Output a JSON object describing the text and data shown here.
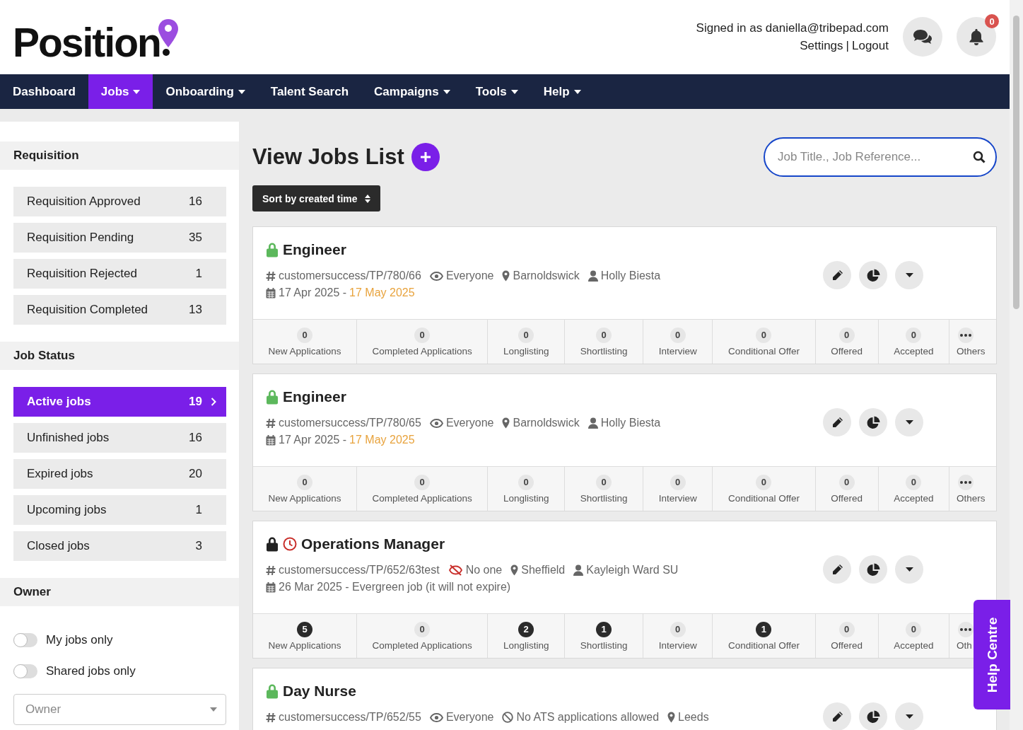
{
  "logo": {
    "text": "Position"
  },
  "account": {
    "signed_in": "Signed in as daniella@tribepad.com",
    "settings": "Settings",
    "separator": "|",
    "logout": "Logout",
    "notifications": "0"
  },
  "nav": [
    {
      "label": "Dashboard",
      "selected": false,
      "dropdown": false
    },
    {
      "label": "Jobs",
      "selected": true,
      "dropdown": true
    },
    {
      "label": "Onboarding",
      "selected": false,
      "dropdown": true
    },
    {
      "label": "Talent Search",
      "selected": false,
      "dropdown": false
    },
    {
      "label": "Campaigns",
      "selected": false,
      "dropdown": true
    },
    {
      "label": "Tools",
      "selected": false,
      "dropdown": true
    },
    {
      "label": "Help",
      "selected": false,
      "dropdown": true
    }
  ],
  "sidebar": {
    "sections": [
      {
        "title": "Requisition",
        "items": [
          {
            "label": "Requisition Approved",
            "count": "16",
            "selected": false
          },
          {
            "label": "Requisition Pending",
            "count": "35",
            "selected": false
          },
          {
            "label": "Requisition Rejected",
            "count": "1",
            "selected": false
          },
          {
            "label": "Requisition Completed",
            "count": "13",
            "selected": false
          }
        ]
      },
      {
        "title": "Job Status",
        "items": [
          {
            "label": "Active jobs",
            "count": "19",
            "selected": true
          },
          {
            "label": "Unfinished jobs",
            "count": "16",
            "selected": false
          },
          {
            "label": "Expired jobs",
            "count": "20",
            "selected": false
          },
          {
            "label": "Upcoming jobs",
            "count": "1",
            "selected": false
          },
          {
            "label": "Closed jobs",
            "count": "3",
            "selected": false
          }
        ]
      }
    ],
    "owner": {
      "title": "Owner",
      "toggles": [
        {
          "label": "My jobs only",
          "on": false
        },
        {
          "label": "Shared jobs only",
          "on": false
        }
      ],
      "select_placeholder": "Owner"
    }
  },
  "main": {
    "title": "View Jobs List",
    "search": {
      "placeholder": "Job Title., Job Reference..."
    },
    "sort": "Sort by created time"
  },
  "jobs": [
    {
      "title": "Engineer",
      "color": "#5cb85c",
      "expired": false,
      "meta": [
        {
          "kind": "reference",
          "text": "customersuccess/TP/780/66"
        },
        {
          "kind": "visible",
          "text": "Everyone"
        },
        {
          "kind": "location",
          "text": "Barnoldswick"
        },
        {
          "kind": "owner",
          "text": "Holly Biesta"
        }
      ],
      "dates": {
        "start": "17 Apr 2025 -",
        "end": "17 May 2025"
      },
      "stages": [
        {
          "kind": "count",
          "count": "0",
          "active": false,
          "label": "New Applications"
        },
        {
          "kind": "count",
          "count": "0",
          "active": false,
          "label": "Completed Applications"
        },
        {
          "kind": "count",
          "count": "0",
          "active": false,
          "label": "Longlisting"
        },
        {
          "kind": "count",
          "count": "0",
          "active": false,
          "label": "Shortlisting"
        },
        {
          "kind": "count",
          "count": "0",
          "active": false,
          "label": "Interview"
        },
        {
          "kind": "count",
          "count": "0",
          "active": false,
          "label": "Conditional Offer"
        },
        {
          "kind": "count",
          "count": "0",
          "active": false,
          "label": "Offered"
        },
        {
          "kind": "count",
          "count": "0",
          "active": false,
          "label": "Accepted"
        },
        {
          "kind": "more",
          "label": "Others"
        }
      ]
    },
    {
      "title": "Engineer",
      "color": "#5cb85c",
      "expired": false,
      "meta": [
        {
          "kind": "reference",
          "text": "customersuccess/TP/780/65"
        },
        {
          "kind": "visible",
          "text": "Everyone"
        },
        {
          "kind": "location",
          "text": "Barnoldswick"
        },
        {
          "kind": "owner",
          "text": "Holly Biesta"
        }
      ],
      "dates": {
        "start": "17 Apr 2025 -",
        "end": "17 May 2025"
      },
      "stages": [
        {
          "kind": "count",
          "count": "0",
          "active": false,
          "label": "New Applications"
        },
        {
          "kind": "count",
          "count": "0",
          "active": false,
          "label": "Completed Applications"
        },
        {
          "kind": "count",
          "count": "0",
          "active": false,
          "label": "Longlisting"
        },
        {
          "kind": "count",
          "count": "0",
          "active": false,
          "label": "Shortlisting"
        },
        {
          "kind": "count",
          "count": "0",
          "active": false,
          "label": "Interview"
        },
        {
          "kind": "count",
          "count": "0",
          "active": false,
          "label": "Conditional Offer"
        },
        {
          "kind": "count",
          "count": "0",
          "active": false,
          "label": "Offered"
        },
        {
          "kind": "count",
          "count": "0",
          "active": false,
          "label": "Accepted"
        },
        {
          "kind": "more",
          "label": "Others"
        }
      ]
    },
    {
      "title": "Operations Manager",
      "color": "#222222",
      "expired": true,
      "meta": [
        {
          "kind": "reference",
          "text": "customersuccess/TP/652/63test"
        },
        {
          "kind": "hidden",
          "text": "No one"
        },
        {
          "kind": "location",
          "text": "Sheffield"
        },
        {
          "kind": "owner",
          "text": "Kayleigh Ward SU"
        }
      ],
      "dates": {
        "start": "26 Mar 2025 - Evergreen job (it will not expire)"
      },
      "stages": [
        {
          "kind": "count",
          "count": "5",
          "active": true,
          "label": "New Applications"
        },
        {
          "kind": "count",
          "count": "0",
          "active": false,
          "label": "Completed Applications"
        },
        {
          "kind": "count",
          "count": "2",
          "active": true,
          "label": "Longlisting"
        },
        {
          "kind": "count",
          "count": "1",
          "active": true,
          "label": "Shortlisting"
        },
        {
          "kind": "count",
          "count": "0",
          "active": false,
          "label": "Interview"
        },
        {
          "kind": "count",
          "count": "1",
          "active": true,
          "label": "Conditional Offer"
        },
        {
          "kind": "count",
          "count": "0",
          "active": false,
          "label": "Offered"
        },
        {
          "kind": "count",
          "count": "0",
          "active": false,
          "label": "Accepted"
        },
        {
          "kind": "more",
          "label": "Oth"
        }
      ]
    },
    {
      "title": "Day Nurse",
      "color": "#5cb85c",
      "expired": false,
      "meta": [
        {
          "kind": "reference",
          "text": "customersuccess/TP/652/55"
        },
        {
          "kind": "visible",
          "text": "Everyone"
        },
        {
          "kind": "no_ats",
          "text": "No ATS applications allowed"
        },
        {
          "kind": "location",
          "text": "Leeds"
        }
      ]
    }
  ],
  "help_tab": "Help Centre"
}
